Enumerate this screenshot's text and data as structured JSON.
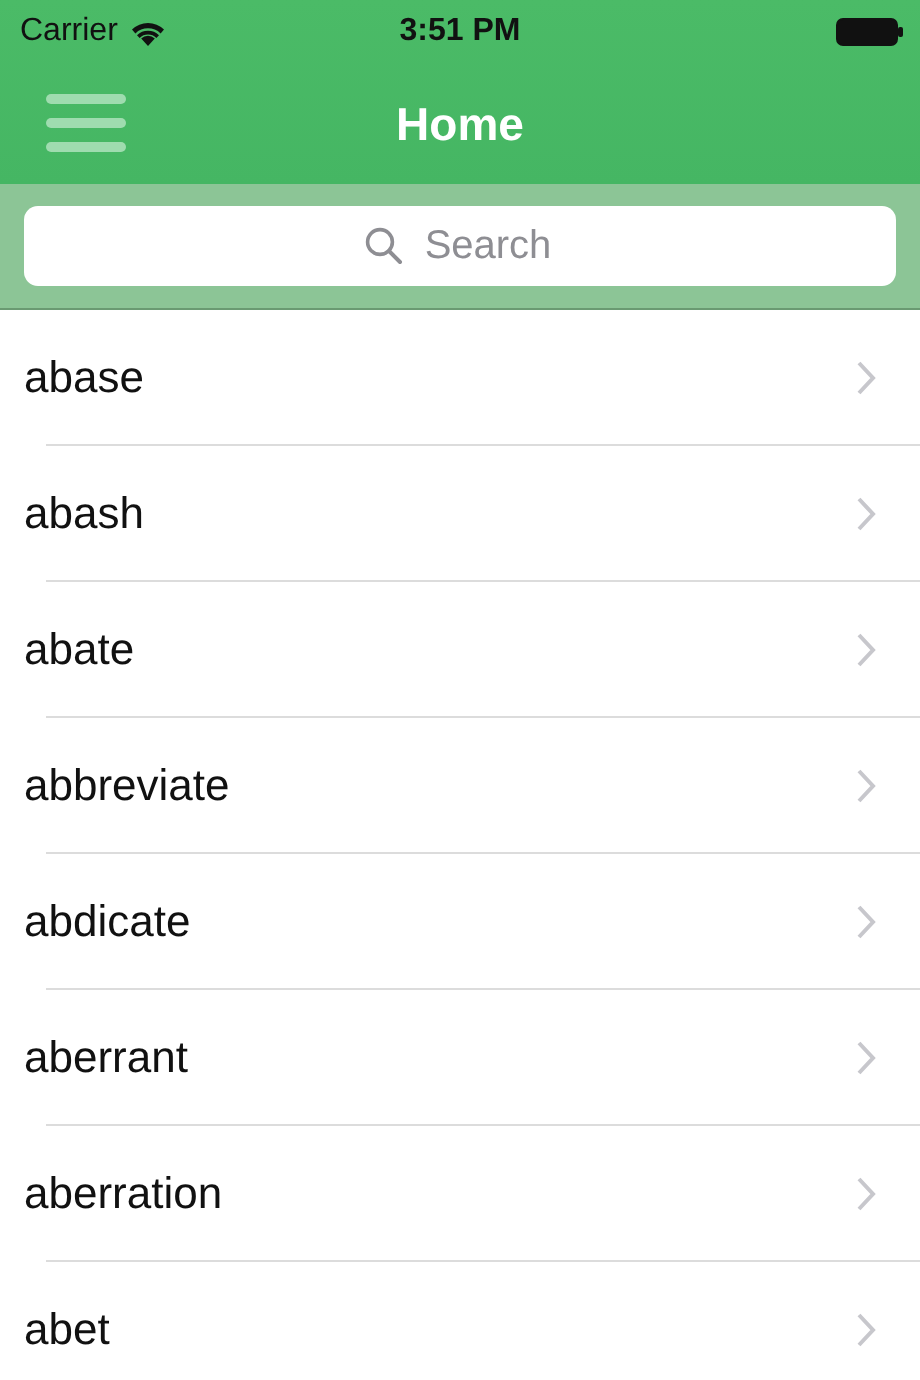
{
  "status_bar": {
    "carrier": "Carrier",
    "time": "3:51 PM"
  },
  "nav_bar": {
    "title": "Home"
  },
  "search": {
    "placeholder": "Search"
  },
  "words": [
    {
      "label": "abase"
    },
    {
      "label": "abash"
    },
    {
      "label": "abate"
    },
    {
      "label": "abbreviate"
    },
    {
      "label": "abdicate"
    },
    {
      "label": "aberrant"
    },
    {
      "label": "aberration"
    },
    {
      "label": "abet"
    }
  ]
}
